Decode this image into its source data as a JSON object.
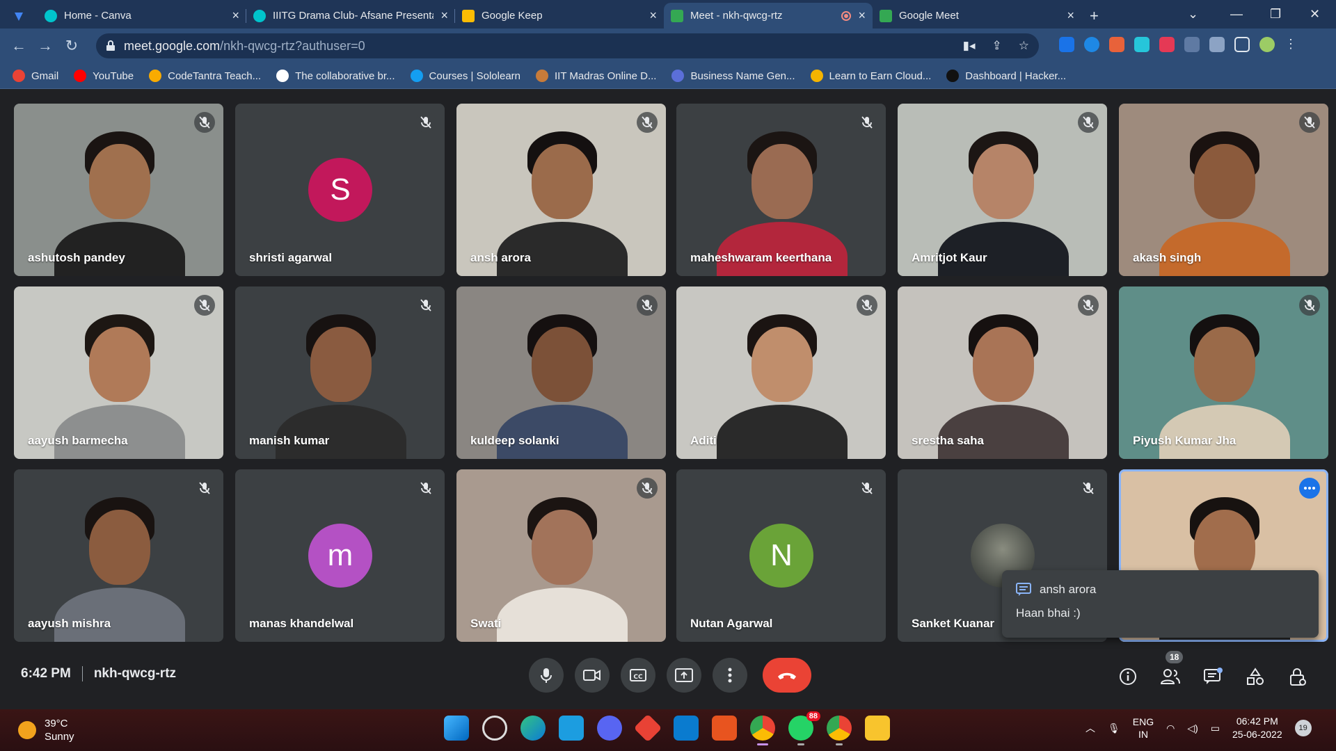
{
  "browser": {
    "tabs": [
      {
        "title": "Home - Canva",
        "color": "#00c4cc"
      },
      {
        "title": "IIITG Drama Club- Afsane Presenta",
        "color": "#00c4cc"
      },
      {
        "title": "Google Keep",
        "color": "#fbbc04"
      },
      {
        "title": "Meet - nkh-qwcg-rtz",
        "color": "#34a853"
      },
      {
        "title": "Google Meet",
        "color": "#34a853"
      }
    ],
    "new_tab": "+",
    "url_host": "meet.google.com",
    "url_path": "/nkh-qwcg-rtz?authuser=0",
    "bookmarks": [
      {
        "label": "Gmail",
        "color": "#ea4335"
      },
      {
        "label": "YouTube",
        "color": "#ff0000"
      },
      {
        "label": "CodeTantra Teach...",
        "color": "#f9ab00"
      },
      {
        "label": "The collaborative br...",
        "color": "#ffffff"
      },
      {
        "label": "Courses | Sololearn",
        "color": "#149ef2"
      },
      {
        "label": "IIT Madras Online D...",
        "color": "#c77b3a"
      },
      {
        "label": "Business Name Gen...",
        "color": "#5b6fd8"
      },
      {
        "label": "Learn to Earn Cloud...",
        "color": "#f4b400"
      },
      {
        "label": "Dashboard | Hacker...",
        "color": "#111111"
      }
    ]
  },
  "participants": [
    {
      "name": "ashutosh pandey",
      "bg": "#8a8f8c",
      "skin": "#a0704e",
      "hair": "#1a1412",
      "shirt": "#222222"
    },
    {
      "name": "shristi agarwal",
      "avatar": "S",
      "avatar_color": "#c2185b"
    },
    {
      "name": "ansh arora",
      "bg": "#c9c6bd",
      "skin": "#9b6b4b",
      "hair": "#141010",
      "shirt": "#2a2a2a"
    },
    {
      "name": "maheshwaram keerthana",
      "bg": "#3c4043",
      "skin": "#9a6b52",
      "hair": "#1b1513",
      "shirt": "#b3263c"
    },
    {
      "name": "Amritjot Kaur",
      "bg": "#b9bdb7",
      "skin": "#b68468",
      "hair": "#1c1614",
      "shirt": "#1d2026"
    },
    {
      "name": "akash singh",
      "bg": "#9e8b7d",
      "skin": "#8b5a3c",
      "hair": "#1a1210",
      "shirt": "#c46a2c"
    },
    {
      "name": "aayush barmecha",
      "bg": "#c7c8c3",
      "skin": "#b07a58",
      "hair": "#1d1713",
      "shirt": "#8d8f8f"
    },
    {
      "name": "manish kumar",
      "bg": "#3c4043",
      "skin": "#8a5b40",
      "hair": "#171211",
      "shirt": "#2c2c2c"
    },
    {
      "name": "kuldeep solanki",
      "bg": "#8a8682",
      "skin": "#7c5138",
      "hair": "#151010",
      "shirt": "#3c4a66"
    },
    {
      "name": "Aditi",
      "bg": "#c8c7c2",
      "skin": "#c08e6c",
      "hair": "#1b1412",
      "shirt": "#2a2a2a"
    },
    {
      "name": "srestha saha",
      "bg": "#c5c2bd",
      "skin": "#a97456",
      "hair": "#161110",
      "shirt": "#4a4040"
    },
    {
      "name": "Piyush Kumar Jha",
      "bg": "#5f8e88",
      "skin": "#9a6a49",
      "hair": "#141010",
      "shirt": "#d4c9b4"
    },
    {
      "name": "aayush mishra",
      "bg": "#3c4043",
      "skin": "#8b5c3f",
      "hair": "#191311",
      "shirt": "#6a6f78"
    },
    {
      "name": "manas khandelwal",
      "avatar": "m",
      "avatar_color": "#b451c4"
    },
    {
      "name": "Swati",
      "bg": "#a99a8f",
      "skin": "#a2735a",
      "hair": "#1b1412",
      "shirt": "#e6e0d8"
    },
    {
      "name": "Nutan Agarwal",
      "avatar": "N",
      "avatar_color": "#6aa338"
    },
    {
      "name": "Sanket Kuanar",
      "photo_avatar": true
    },
    {
      "name": "",
      "self": true,
      "bg": "#d9c0a4",
      "skin": "#a16d4c",
      "hair": "#171210",
      "shirt": "#2c2c2c"
    }
  ],
  "chat_popup": {
    "sender": "ansh arora",
    "message": "Haan bhai :)"
  },
  "meeting": {
    "time": "6:42 PM",
    "code": "nkh-qwcg-rtz",
    "participant_count": "18"
  },
  "taskbar": {
    "temperature": "39°C",
    "condition": "Sunny",
    "whatsapp_badge": "88",
    "lang_top": "ENG",
    "lang_bottom": "IN",
    "clock_time": "06:42 PM",
    "clock_date": "25-06-2022",
    "notifications": "19"
  },
  "colors": {
    "meet_bg": "#202124",
    "end_call": "#ea4335",
    "accent": "#8ab4f8"
  }
}
